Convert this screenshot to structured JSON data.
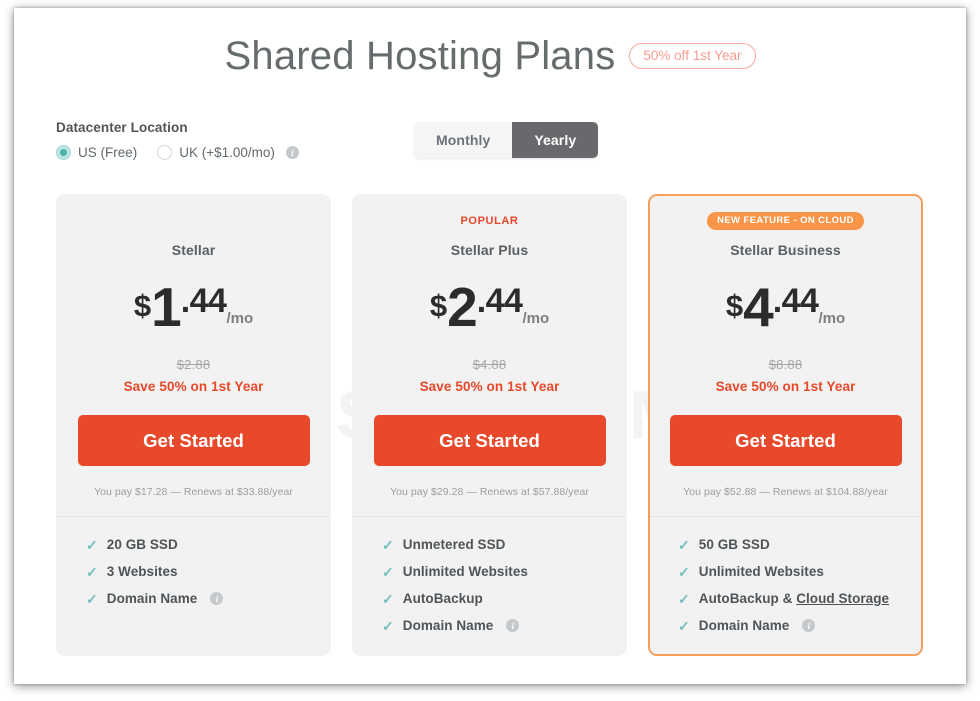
{
  "header": {
    "title": "Shared Hosting Plans",
    "badge": "50% off 1st Year"
  },
  "watermark": "ORIDSITE.COM",
  "controls": {
    "datacenter_label": "Datacenter Location",
    "radios": [
      {
        "label": "US (Free)",
        "selected": true,
        "info": false
      },
      {
        "label": "UK (+$1.00/mo)",
        "selected": false,
        "info": true
      }
    ],
    "billing_toggle": {
      "monthly_label": "Monthly",
      "yearly_label": "Yearly",
      "active": "Yearly"
    }
  },
  "info_glyph": "i",
  "check_glyph": "✓",
  "colors": {
    "cta": "#e8492a",
    "save_text": "#e8492a",
    "popular": "#e9452a",
    "new_badge": "#f89548",
    "highlight_border": "#f3a05f",
    "check": "#73bfbb",
    "radio_on": "#4bb3ad",
    "title_badge": "#f79c92"
  },
  "plans": [
    {
      "badge_type": "none",
      "badge_text": "",
      "name": "Stellar",
      "currency": "$",
      "price_whole": "1",
      "price_cents": ".44",
      "per": "/mo",
      "old_price": "$2.88",
      "save_text": "Save 50% on 1st Year",
      "cta_label": "Get Started",
      "renew_note": "You pay $17.28 — Renews at $33.88/year",
      "features": [
        {
          "text": "20 GB SSD",
          "info": false,
          "underline": ""
        },
        {
          "text": "3 Websites",
          "info": false,
          "underline": ""
        },
        {
          "text": "Domain Name",
          "info": true,
          "underline": ""
        }
      ]
    },
    {
      "badge_type": "popular",
      "badge_text": "POPULAR",
      "name": "Stellar Plus",
      "currency": "$",
      "price_whole": "2",
      "price_cents": ".44",
      "per": "/mo",
      "old_price": "$4.88",
      "save_text": "Save 50% on 1st Year",
      "cta_label": "Get Started",
      "renew_note": "You pay $29.28 — Renews at $57.88/year",
      "features": [
        {
          "text": "Unmetered SSD",
          "info": false,
          "underline": ""
        },
        {
          "text": "Unlimited Websites",
          "info": false,
          "underline": ""
        },
        {
          "text": "AutoBackup",
          "info": false,
          "underline": ""
        },
        {
          "text": "Domain Name",
          "info": true,
          "underline": ""
        }
      ]
    },
    {
      "badge_type": "new",
      "badge_text": "NEW FEATURE - ON CLOUD",
      "name": "Stellar Business",
      "currency": "$",
      "price_whole": "4",
      "price_cents": ".44",
      "per": "/mo",
      "old_price": "$8.88",
      "save_text": "Save 50% on 1st Year",
      "cta_label": "Get Started",
      "renew_note": "You pay $52.88 — Renews at $104.88/year",
      "features": [
        {
          "text": "50 GB SSD",
          "info": false,
          "underline": ""
        },
        {
          "text": "Unlimited Websites",
          "info": false,
          "underline": ""
        },
        {
          "text": "AutoBackup & ",
          "info": false,
          "underline": "Cloud Storage"
        },
        {
          "text": "Domain Name",
          "info": true,
          "underline": ""
        }
      ]
    }
  ]
}
